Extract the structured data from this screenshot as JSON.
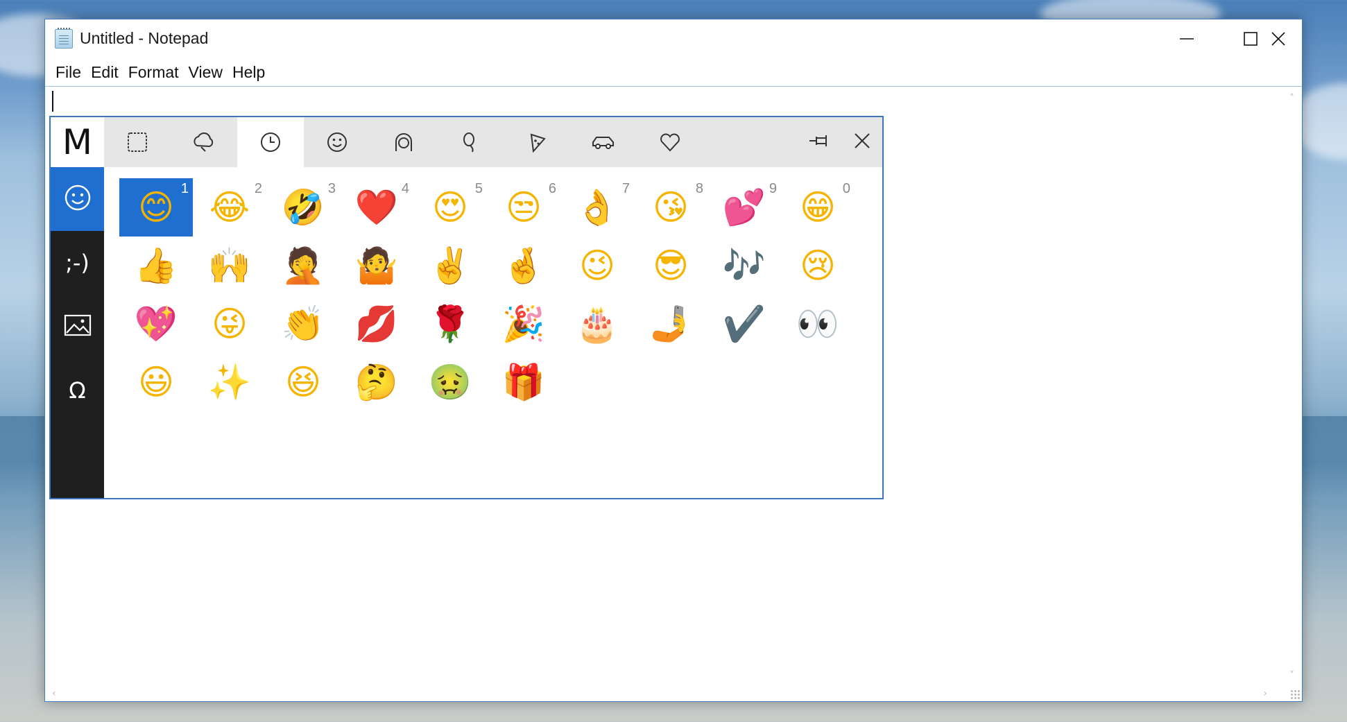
{
  "window": {
    "title": "Untitled - Notepad",
    "controls": {
      "minimize": "minimize-icon",
      "maximize": "maximize-icon",
      "close": "close-icon"
    }
  },
  "menu": [
    {
      "label": "File"
    },
    {
      "label": "Edit"
    },
    {
      "label": "Format"
    },
    {
      "label": "View"
    },
    {
      "label": "Help"
    }
  ],
  "editor": {
    "content": ""
  },
  "emoji_panel": {
    "logo": "M",
    "category_tabs": [
      {
        "name": "tab-people",
        "icon": "smiley-frame-icon"
      },
      {
        "name": "tab-nature",
        "icon": "cloud-icon"
      },
      {
        "name": "tab-recent",
        "icon": "clock-icon",
        "selected": true
      },
      {
        "name": "tab-smileys",
        "icon": "smiley-icon"
      },
      {
        "name": "tab-person",
        "icon": "person-icon"
      },
      {
        "name": "tab-celebration",
        "icon": "balloon-icon"
      },
      {
        "name": "tab-food",
        "icon": "pizza-icon"
      },
      {
        "name": "tab-travel",
        "icon": "car-icon"
      },
      {
        "name": "tab-symbols",
        "icon": "heart-icon"
      }
    ],
    "side_tabs": [
      {
        "name": "side-emoji",
        "icon": "smiley-icon",
        "selected": true
      },
      {
        "name": "side-kaomoji",
        "label": ";-)"
      },
      {
        "name": "side-gif",
        "icon": "image-icon"
      },
      {
        "name": "side-symbols",
        "label": "Ω"
      }
    ],
    "accent_color": "#1f6fd1",
    "emojis": [
      {
        "char": "😊",
        "num": "1",
        "selected": true
      },
      {
        "char": "😂",
        "num": "2"
      },
      {
        "char": "🤣",
        "num": "3"
      },
      {
        "char": "❤️",
        "num": "4"
      },
      {
        "char": "😍",
        "num": "5"
      },
      {
        "char": "😒",
        "num": "6"
      },
      {
        "char": "👌",
        "num": "7"
      },
      {
        "char": "😘",
        "num": "8"
      },
      {
        "char": "💕",
        "num": "9"
      },
      {
        "char": "😁",
        "num": "0"
      },
      {
        "char": "👍"
      },
      {
        "char": "🙌"
      },
      {
        "char": "🤦"
      },
      {
        "char": "🤷"
      },
      {
        "char": "✌️"
      },
      {
        "char": "🤞"
      },
      {
        "char": "😉"
      },
      {
        "char": "😎"
      },
      {
        "char": "🎶"
      },
      {
        "char": "😢"
      },
      {
        "char": "💖"
      },
      {
        "char": "😜"
      },
      {
        "char": "👏"
      },
      {
        "char": "💋"
      },
      {
        "char": "🌹"
      },
      {
        "char": "🎉"
      },
      {
        "char": "🎂"
      },
      {
        "char": "🤳"
      },
      {
        "char": "✔️"
      },
      {
        "char": "👀"
      },
      {
        "char": "😃"
      },
      {
        "char": "✨"
      },
      {
        "char": "😆"
      },
      {
        "char": "🤔"
      },
      {
        "char": "🤢"
      },
      {
        "char": "🎁"
      }
    ]
  }
}
